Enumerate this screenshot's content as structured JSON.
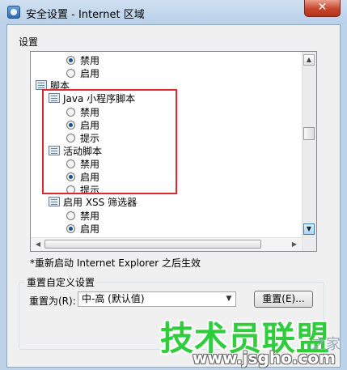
{
  "window": {
    "title": "安全设置 - Internet 区域",
    "close_glyph": "✕"
  },
  "settings_label": "设置",
  "list_rows": [
    {
      "kind": "radio",
      "label": "禁用",
      "checked": true
    },
    {
      "kind": "radio",
      "label": "启用",
      "checked": false
    },
    {
      "kind": "group",
      "label": "脚本",
      "icon": "settings-group-icon"
    },
    {
      "kind": "group",
      "label": "Java 小程序脚本",
      "icon": "settings-group-icon"
    },
    {
      "kind": "radio",
      "label": "禁用",
      "checked": false
    },
    {
      "kind": "radio",
      "label": "启用",
      "checked": true
    },
    {
      "kind": "radio",
      "label": "提示",
      "checked": false
    },
    {
      "kind": "group",
      "label": "活动脚本",
      "icon": "settings-group-icon"
    },
    {
      "kind": "radio",
      "label": "禁用",
      "checked": false
    },
    {
      "kind": "radio",
      "label": "启用",
      "checked": true
    },
    {
      "kind": "radio",
      "label": "提示",
      "checked": false
    },
    {
      "kind": "group",
      "label": "启用 XSS 筛选器",
      "icon": "settings-group-icon"
    },
    {
      "kind": "radio",
      "label": "禁用",
      "checked": false
    },
    {
      "kind": "radio",
      "label": "启用",
      "checked": true
    }
  ],
  "note": "*重新启动 Internet Explorer 之后生效",
  "reset_group": {
    "title": "重置自定义设置",
    "reset_to_label": "重置为(R):",
    "selected_level": "中-高 (默认值)",
    "reset_button": "重置(E)..."
  },
  "watermark": {
    "text": "技术员联盟",
    "url": "www.jsgho.com",
    "tail": "之家"
  },
  "colors": {
    "highlight_box": "#e0262e",
    "watermark_green": "#2fcc3b",
    "radio_dot": "#1f4d8a"
  }
}
